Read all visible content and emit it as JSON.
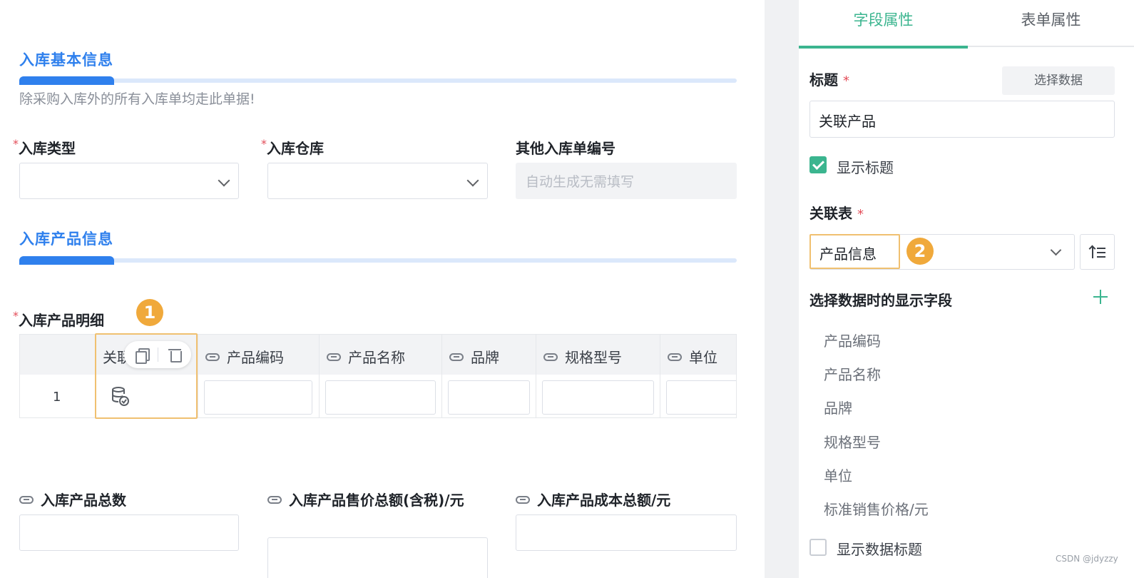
{
  "form": {
    "section1": {
      "title": "入库基本信息",
      "description": "除采购入库外的所有入库单均走此单据!"
    },
    "fields_row1": [
      {
        "label": "入库类型",
        "required": true,
        "type": "select",
        "value": ""
      },
      {
        "label": "入库仓库",
        "required": true,
        "type": "select",
        "value": ""
      },
      {
        "label": "其他入库单编号",
        "required": false,
        "type": "text",
        "placeholder": "自动生成无需填写"
      }
    ],
    "section2": {
      "title": "入库产品信息"
    },
    "detail": {
      "label": "入库产品明细",
      "required": true,
      "badge": "1",
      "columns": [
        "关联",
        "产品编码",
        "产品名称",
        "品牌",
        "规格型号",
        "单位"
      ],
      "rows": [
        {
          "index": "1"
        }
      ]
    },
    "totals": [
      {
        "label": "入库产品总数"
      },
      {
        "label": "入库产品售价总额(含税)/元"
      },
      {
        "label": "入库产品成本总额/元"
      }
    ]
  },
  "panel": {
    "tabs": [
      {
        "label": "字段属性",
        "active": true
      },
      {
        "label": "表单属性",
        "active": false
      }
    ],
    "title_label": "标题",
    "select_data_button": "选择数据",
    "title_value": "关联产品",
    "show_title_label": "显示标题",
    "show_title_checked": true,
    "related_table_label": "关联表",
    "related_table_value": "产品信息",
    "badge": "2",
    "display_fields_label": "选择数据时的显示字段",
    "display_fields": [
      "产品编码",
      "产品名称",
      "品牌",
      "规格型号",
      "单位",
      "标准销售价格/元"
    ],
    "show_data_title_label": "显示数据标题",
    "show_data_title_checked": false
  },
  "watermark": "CSDN @jdyzzy",
  "colors": {
    "primary_blue": "#2f80ed",
    "accent_green": "#3bb58f",
    "highlight_orange": "#f0a93b",
    "required_red": "#e34d59"
  }
}
